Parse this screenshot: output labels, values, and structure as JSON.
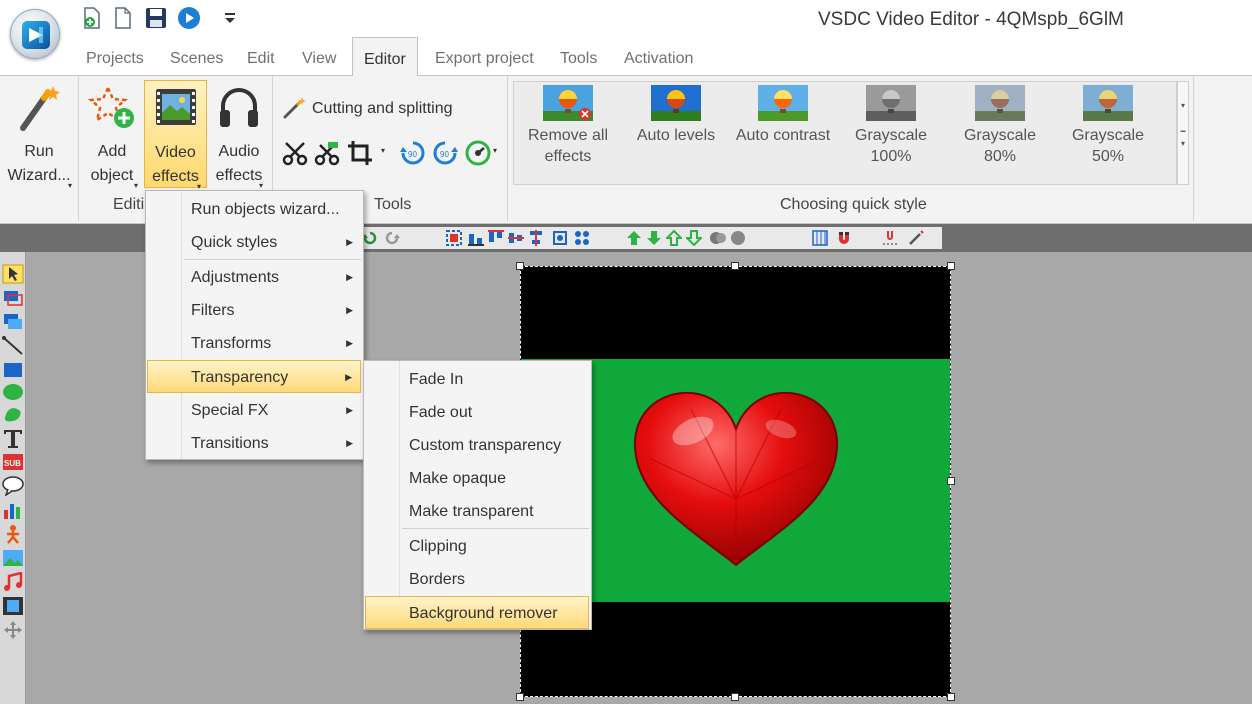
{
  "window": {
    "title": "VSDC Video Editor - 4QMspb_6GlM"
  },
  "quick_access": [
    "new-project-icon",
    "new-document-icon",
    "save-icon",
    "play-icon",
    "customize-quick-access-icon"
  ],
  "tabs": [
    {
      "label": "Projects"
    },
    {
      "label": "Scenes"
    },
    {
      "label": "Edit"
    },
    {
      "label": "View"
    },
    {
      "label": "Editor"
    },
    {
      "label": "Export project"
    },
    {
      "label": "Tools"
    },
    {
      "label": "Activation"
    }
  ],
  "active_tab": "Editor",
  "ribbon": {
    "run_wizard": {
      "line1": "Run",
      "line2": "Wizard..."
    },
    "add_object": {
      "line1": "Add",
      "line2": "object"
    },
    "video_effects": {
      "line1": "Video",
      "line2": "effects"
    },
    "audio_effects": {
      "line1": "Audio",
      "line2": "effects"
    },
    "cutting_splitting": "Cutting and splitting",
    "group_editing": "Editi",
    "group_tools": "Tools",
    "group_quick_style": "Choosing quick style",
    "quick_styles": [
      {
        "line1": "Remove all",
        "line2": "effects"
      },
      {
        "line1": "Auto levels",
        "line2": ""
      },
      {
        "line1": "Auto contrast",
        "line2": ""
      },
      {
        "line1": "Grayscale",
        "line2": "100%"
      },
      {
        "line1": "Grayscale 80%",
        "line2": ""
      },
      {
        "line1": "Grayscale 50%",
        "line2": ""
      }
    ],
    "rotate_left_label": "90",
    "rotate_right_label": "90"
  },
  "video_effects_menu": {
    "items": [
      {
        "label": "Run objects wizard...",
        "submenu": false
      },
      {
        "label": "Quick styles",
        "submenu": true
      },
      {
        "label": "Adjustments",
        "submenu": true
      },
      {
        "label": "Filters",
        "submenu": true
      },
      {
        "label": "Transforms",
        "submenu": true
      },
      {
        "label": "Transparency",
        "submenu": true,
        "highlighted": true
      },
      {
        "label": "Special FX",
        "submenu": true
      },
      {
        "label": "Transitions",
        "submenu": true
      }
    ]
  },
  "transparency_menu": {
    "items": [
      {
        "label": "Fade In"
      },
      {
        "label": "Fade out"
      },
      {
        "label": "Custom transparency"
      },
      {
        "label": "Make opaque"
      },
      {
        "label": "Make transparent"
      },
      {
        "label": "Clipping"
      },
      {
        "label": "Borders"
      },
      {
        "label": "Background remover",
        "highlighted": true
      }
    ]
  },
  "canvas": {
    "background_color": "#10a83a",
    "object": "red heart"
  },
  "colors": {
    "accent_highlight": "#ffd978",
    "chroma_green": "#10a83a",
    "ribbon_bg": "#f3f3f3"
  }
}
